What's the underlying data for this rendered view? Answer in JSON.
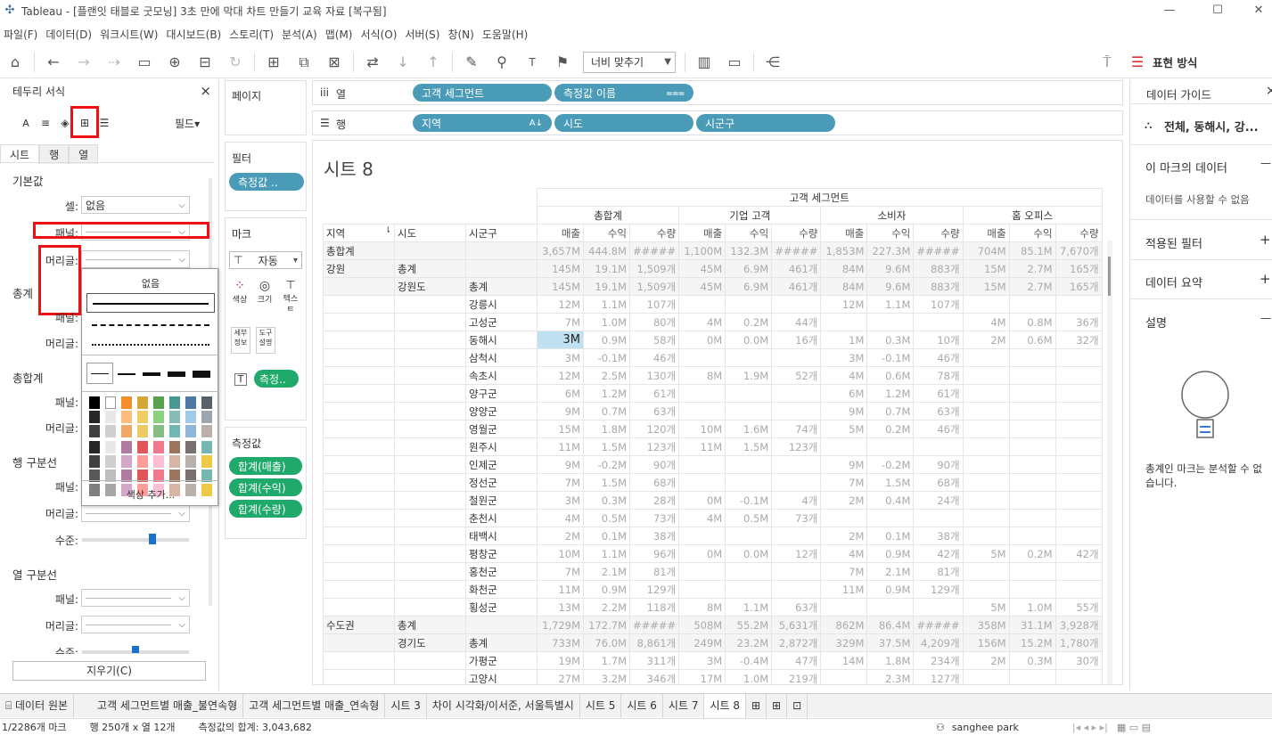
{
  "title": "Tableau - [플랜잇 태블로 굿모닝] 3초 만에 막대 차트 만들기 교육 자료 [복구됨]",
  "window_controls": [
    "—",
    "☐",
    "✕"
  ],
  "menu": [
    "파일(F)",
    "데이터(D)",
    "워크시트(W)",
    "대시보드(B)",
    "스토리(T)",
    "분석(A)",
    "맵(M)",
    "서식(O)",
    "서버(S)",
    "창(N)",
    "도움말(H)"
  ],
  "toolbar": {
    "fit": "너비 맞추기",
    "show_me": "표현 방식"
  },
  "format_panel": {
    "title": "테두리 서식",
    "close": "×",
    "field_btn": "필드▾",
    "tabs": [
      "시트",
      "행",
      "열"
    ],
    "sections": {
      "default": "기본값",
      "totals": "총계",
      "grand_totals": "총합계",
      "row_dividers": "행 구분선",
      "col_dividers": "열 구분선"
    },
    "labels": {
      "cell": "셀:",
      "pane": "패널:",
      "header": "머리글:",
      "level": "수준:"
    },
    "cell_value": "없음",
    "clear_btn": "지우기(C)",
    "popup": {
      "none": "없음",
      "add_color": "색상 추가..."
    }
  },
  "cards": {
    "pages": "페이지",
    "filters": "필터",
    "filter_pill": "측정값 ..",
    "marks": "마크",
    "mark_type": "자동",
    "marks_buttons": [
      "색상",
      "크기",
      "텍스트",
      "세부 정보",
      "도구 설명"
    ],
    "label_pill": "측정..",
    "measure_values": "측정값",
    "measures": [
      "합계(매출)",
      "합계(수익)",
      "합계(수량)"
    ]
  },
  "shelves": {
    "columns_label": "열",
    "rows_label": "행",
    "columns": [
      "고객 세그먼트",
      "측정값 이름"
    ],
    "rows": [
      "지역",
      "시도",
      "시군구"
    ]
  },
  "sheet_title": "시트 8",
  "table": {
    "top_header": "고객 세그먼트",
    "segments": [
      "총합계",
      "기업 고객",
      "소비자",
      "홈 오피스"
    ],
    "measures": [
      "매출",
      "수익",
      "수량"
    ],
    "row_headers": [
      "지역",
      "시도",
      "시군구"
    ],
    "rows": [
      {
        "a": "총합계",
        "b": "",
        "c": "",
        "v": [
          "3,657M",
          "444.8M",
          "#####",
          "1,100M",
          "132.3M",
          "#####",
          "1,853M",
          "227.3M",
          "#####",
          "704M",
          "85.1M",
          "7,670개"
        ],
        "tot": true
      },
      {
        "a": "강원",
        "b": "총계",
        "c": "",
        "v": [
          "145M",
          "19.1M",
          "1,509개",
          "45M",
          "6.9M",
          "461개",
          "84M",
          "9.6M",
          "883개",
          "15M",
          "2.7M",
          "165개"
        ],
        "tot": true
      },
      {
        "a": "",
        "b": "강원도",
        "c": "총계",
        "v": [
          "145M",
          "19.1M",
          "1,509개",
          "45M",
          "6.9M",
          "461개",
          "84M",
          "9.6M",
          "883개",
          "15M",
          "2.7M",
          "165개"
        ],
        "tot": true
      },
      {
        "a": "",
        "b": "",
        "c": "강릉시",
        "v": [
          "12M",
          "1.1M",
          "107개",
          "",
          "",
          "",
          "12M",
          "1.1M",
          "107개",
          "",
          "",
          ""
        ]
      },
      {
        "a": "",
        "b": "",
        "c": "고성군",
        "v": [
          "7M",
          "1.0M",
          "80개",
          "4M",
          "0.2M",
          "44개",
          "",
          "",
          "",
          "4M",
          "0.8M",
          "36개"
        ]
      },
      {
        "a": "",
        "b": "",
        "c": "동해시",
        "v": [
          "3M",
          "0.9M",
          "58개",
          "0M",
          "0.0M",
          "16개",
          "1M",
          "0.3M",
          "10개",
          "2M",
          "0.6M",
          "32개"
        ],
        "sel": true
      },
      {
        "a": "",
        "b": "",
        "c": "삼척시",
        "v": [
          "3M",
          "-0.1M",
          "46개",
          "",
          "",
          "",
          "3M",
          "-0.1M",
          "46개",
          "",
          "",
          ""
        ]
      },
      {
        "a": "",
        "b": "",
        "c": "속초시",
        "v": [
          "12M",
          "2.5M",
          "130개",
          "8M",
          "1.9M",
          "52개",
          "4M",
          "0.6M",
          "78개",
          "",
          "",
          ""
        ]
      },
      {
        "a": "",
        "b": "",
        "c": "양구군",
        "v": [
          "6M",
          "1.2M",
          "61개",
          "",
          "",
          "",
          "6M",
          "1.2M",
          "61개",
          "",
          "",
          ""
        ]
      },
      {
        "a": "",
        "b": "",
        "c": "양양군",
        "v": [
          "9M",
          "0.7M",
          "63개",
          "",
          "",
          "",
          "9M",
          "0.7M",
          "63개",
          "",
          "",
          ""
        ]
      },
      {
        "a": "",
        "b": "",
        "c": "영월군",
        "v": [
          "15M",
          "1.8M",
          "120개",
          "10M",
          "1.6M",
          "74개",
          "5M",
          "0.2M",
          "46개",
          "",
          "",
          ""
        ]
      },
      {
        "a": "",
        "b": "",
        "c": "원주시",
        "v": [
          "11M",
          "1.5M",
          "123개",
          "11M",
          "1.5M",
          "123개",
          "",
          "",
          "",
          "",
          "",
          ""
        ]
      },
      {
        "a": "",
        "b": "",
        "c": "인제군",
        "v": [
          "9M",
          "-0.2M",
          "90개",
          "",
          "",
          "",
          "9M",
          "-0.2M",
          "90개",
          "",
          "",
          ""
        ]
      },
      {
        "a": "",
        "b": "",
        "c": "정선군",
        "v": [
          "7M",
          "1.5M",
          "68개",
          "",
          "",
          "",
          "7M",
          "1.5M",
          "68개",
          "",
          "",
          ""
        ]
      },
      {
        "a": "",
        "b": "",
        "c": "철원군",
        "v": [
          "3M",
          "0.3M",
          "28개",
          "0M",
          "-0.1M",
          "4개",
          "2M",
          "0.4M",
          "24개",
          "",
          "",
          ""
        ]
      },
      {
        "a": "",
        "b": "",
        "c": "춘천시",
        "v": [
          "4M",
          "0.5M",
          "73개",
          "4M",
          "0.5M",
          "73개",
          "",
          "",
          "",
          "",
          "",
          ""
        ]
      },
      {
        "a": "",
        "b": "",
        "c": "태백시",
        "v": [
          "2M",
          "0.1M",
          "38개",
          "",
          "",
          "",
          "2M",
          "0.1M",
          "38개",
          "",
          "",
          ""
        ]
      },
      {
        "a": "",
        "b": "",
        "c": "평창군",
        "v": [
          "10M",
          "1.1M",
          "96개",
          "0M",
          "0.0M",
          "12개",
          "4M",
          "0.9M",
          "42개",
          "5M",
          "0.2M",
          "42개"
        ]
      },
      {
        "a": "",
        "b": "",
        "c": "홍천군",
        "v": [
          "7M",
          "2.1M",
          "81개",
          "",
          "",
          "",
          "7M",
          "2.1M",
          "81개",
          "",
          "",
          ""
        ]
      },
      {
        "a": "",
        "b": "",
        "c": "화천군",
        "v": [
          "11M",
          "0.9M",
          "129개",
          "",
          "",
          "",
          "11M",
          "0.9M",
          "129개",
          "",
          "",
          ""
        ]
      },
      {
        "a": "",
        "b": "",
        "c": "횡성군",
        "v": [
          "13M",
          "2.2M",
          "118개",
          "8M",
          "1.1M",
          "63개",
          "",
          "",
          "",
          "5M",
          "1.0M",
          "55개"
        ]
      },
      {
        "a": "수도권",
        "b": "총계",
        "c": "",
        "v": [
          "1,729M",
          "172.7M",
          "#####",
          "508M",
          "55.2M",
          "5,631개",
          "862M",
          "86.4M",
          "#####",
          "358M",
          "31.1M",
          "3,928개"
        ],
        "tot": true
      },
      {
        "a": "",
        "b": "경기도",
        "c": "총계",
        "v": [
          "733M",
          "76.0M",
          "8,861개",
          "249M",
          "23.2M",
          "2,872개",
          "329M",
          "37.5M",
          "4,209개",
          "156M",
          "15.2M",
          "1,780개"
        ],
        "tot": true
      },
      {
        "a": "",
        "b": "",
        "c": "가평군",
        "v": [
          "19M",
          "1.7M",
          "311개",
          "3M",
          "-0.4M",
          "47개",
          "14M",
          "1.8M",
          "234개",
          "2M",
          "0.3M",
          "30개"
        ]
      },
      {
        "a": "",
        "b": "",
        "c": "고양시",
        "v": [
          "27M",
          "3.2M",
          "346개",
          "17M",
          "1.0M",
          "219개",
          "",
          "2.3M",
          "127개",
          "",
          "",
          ""
        ]
      }
    ]
  },
  "guide": {
    "title": "데이터 가이드",
    "close": "×",
    "breadcrumb": "전체, 동해시, 강...",
    "mark_data": "이 마크의 데이터",
    "mark_data_msg": "데이터를 사용할 수 없음",
    "filters": "적용된 필터",
    "summary": "데이터 요약",
    "desc": "설명",
    "desc_msg": "총계인 마크는 분석할 수 없습니다."
  },
  "sheet_tabs": [
    "데이터 원본",
    "고객 세그먼트별 매출_불연속형",
    "고객 세그먼트별 매출_연속형",
    "시트 3",
    "차이 시각화/이서준, 서울특별시",
    "시트 5",
    "시트 6",
    "시트 7",
    "시트 8"
  ],
  "status": {
    "marks": "1/2286개 마크",
    "dims": "행 250개 x 열 12개",
    "sum": "측정값의 합계: 3,043,682",
    "user": "sanghee park"
  }
}
